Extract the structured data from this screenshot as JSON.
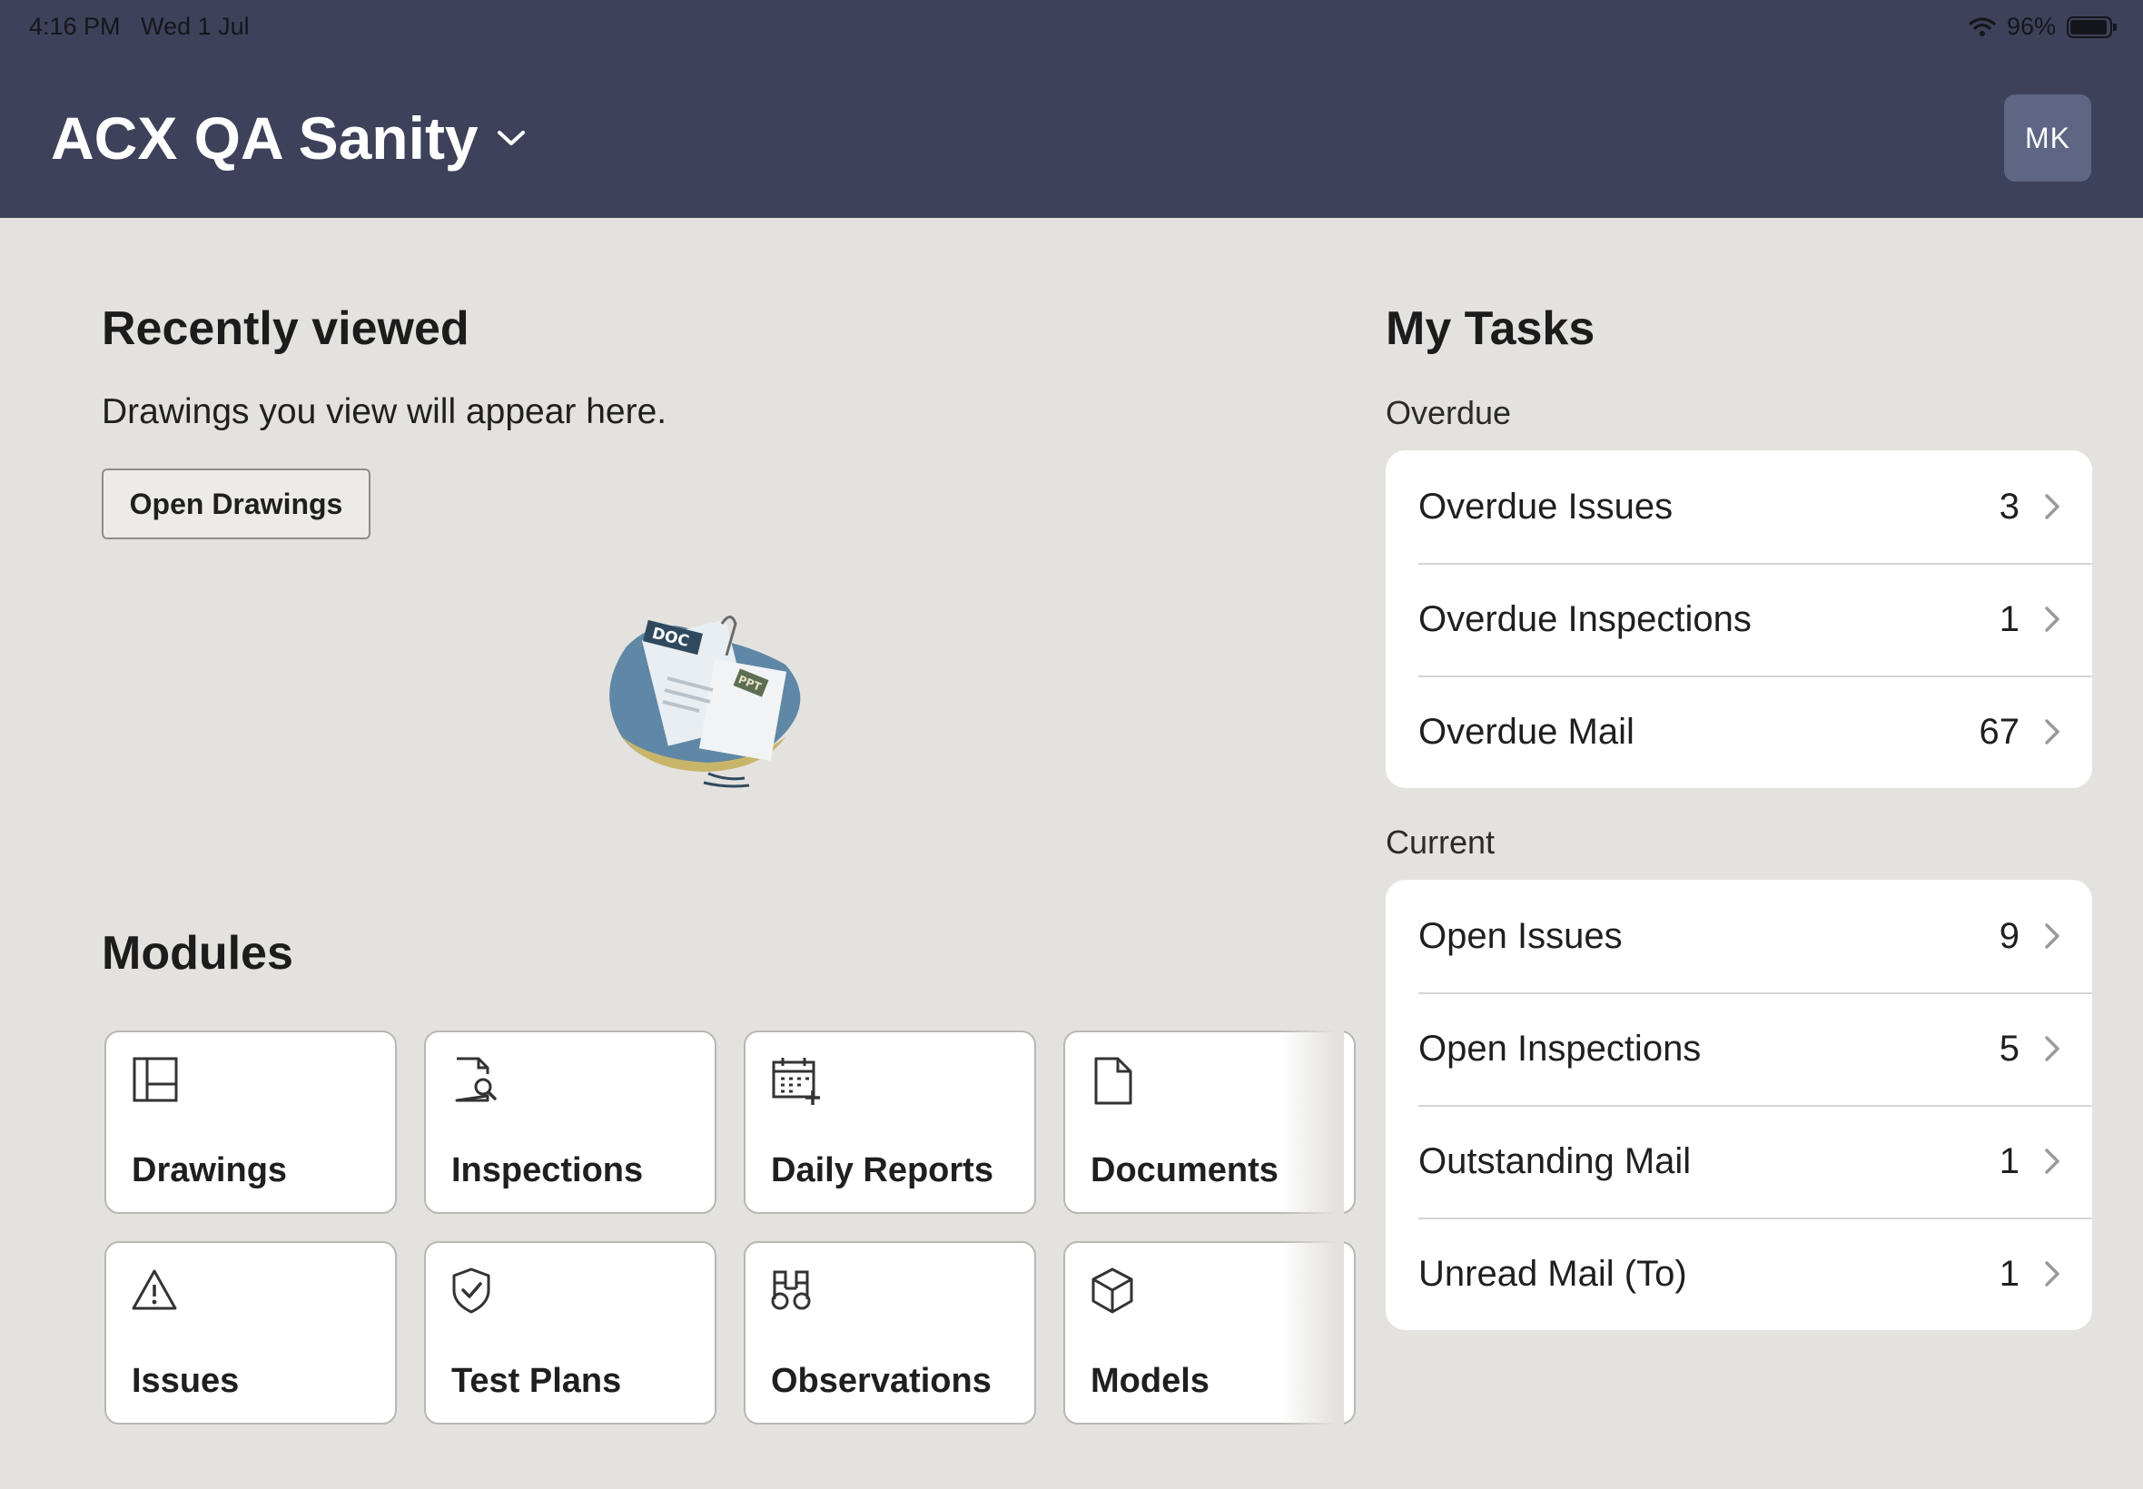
{
  "status_bar": {
    "time": "4:16 PM",
    "date": "Wed 1 Jul",
    "battery": "96%",
    "battery_level": 0.96
  },
  "header": {
    "project": "ACX QA Sanity",
    "avatar_initials": "MK",
    "colors": {
      "background": "#3d4159",
      "avatar": "#5e6684"
    }
  },
  "recent": {
    "title": "Recently viewed",
    "empty_message": "Drawings you view will appear here.",
    "button": "Open Drawings",
    "illustration": {
      "tag_doc": "DOC",
      "tag_ppt": "PPT"
    }
  },
  "modules": {
    "title": "Modules",
    "items": [
      {
        "label": "Drawings",
        "icon": "drawings-icon"
      },
      {
        "label": "Inspections",
        "icon": "inspections-icon"
      },
      {
        "label": "Daily Reports",
        "icon": "daily-reports-icon"
      },
      {
        "label": "Documents",
        "icon": "document-icon"
      },
      {
        "label": "Issues",
        "icon": "warning-icon"
      },
      {
        "label": "Test Plans",
        "icon": "shield-check-icon"
      },
      {
        "label": "Observations",
        "icon": "binoculars-icon"
      },
      {
        "label": "Models",
        "icon": "cube-icon"
      }
    ]
  },
  "tasks": {
    "title": "My Tasks",
    "overdue": {
      "heading": "Overdue",
      "rows": [
        {
          "label": "Overdue Issues",
          "count": "3"
        },
        {
          "label": "Overdue Inspections",
          "count": "1"
        },
        {
          "label": "Overdue Mail",
          "count": "67"
        }
      ]
    },
    "current": {
      "heading": "Current",
      "rows": [
        {
          "label": "Open Issues",
          "count": "9"
        },
        {
          "label": "Open Inspections",
          "count": "5"
        },
        {
          "label": "Outstanding Mail",
          "count": "1"
        },
        {
          "label": "Unread Mail (To)",
          "count": "1"
        }
      ]
    }
  }
}
